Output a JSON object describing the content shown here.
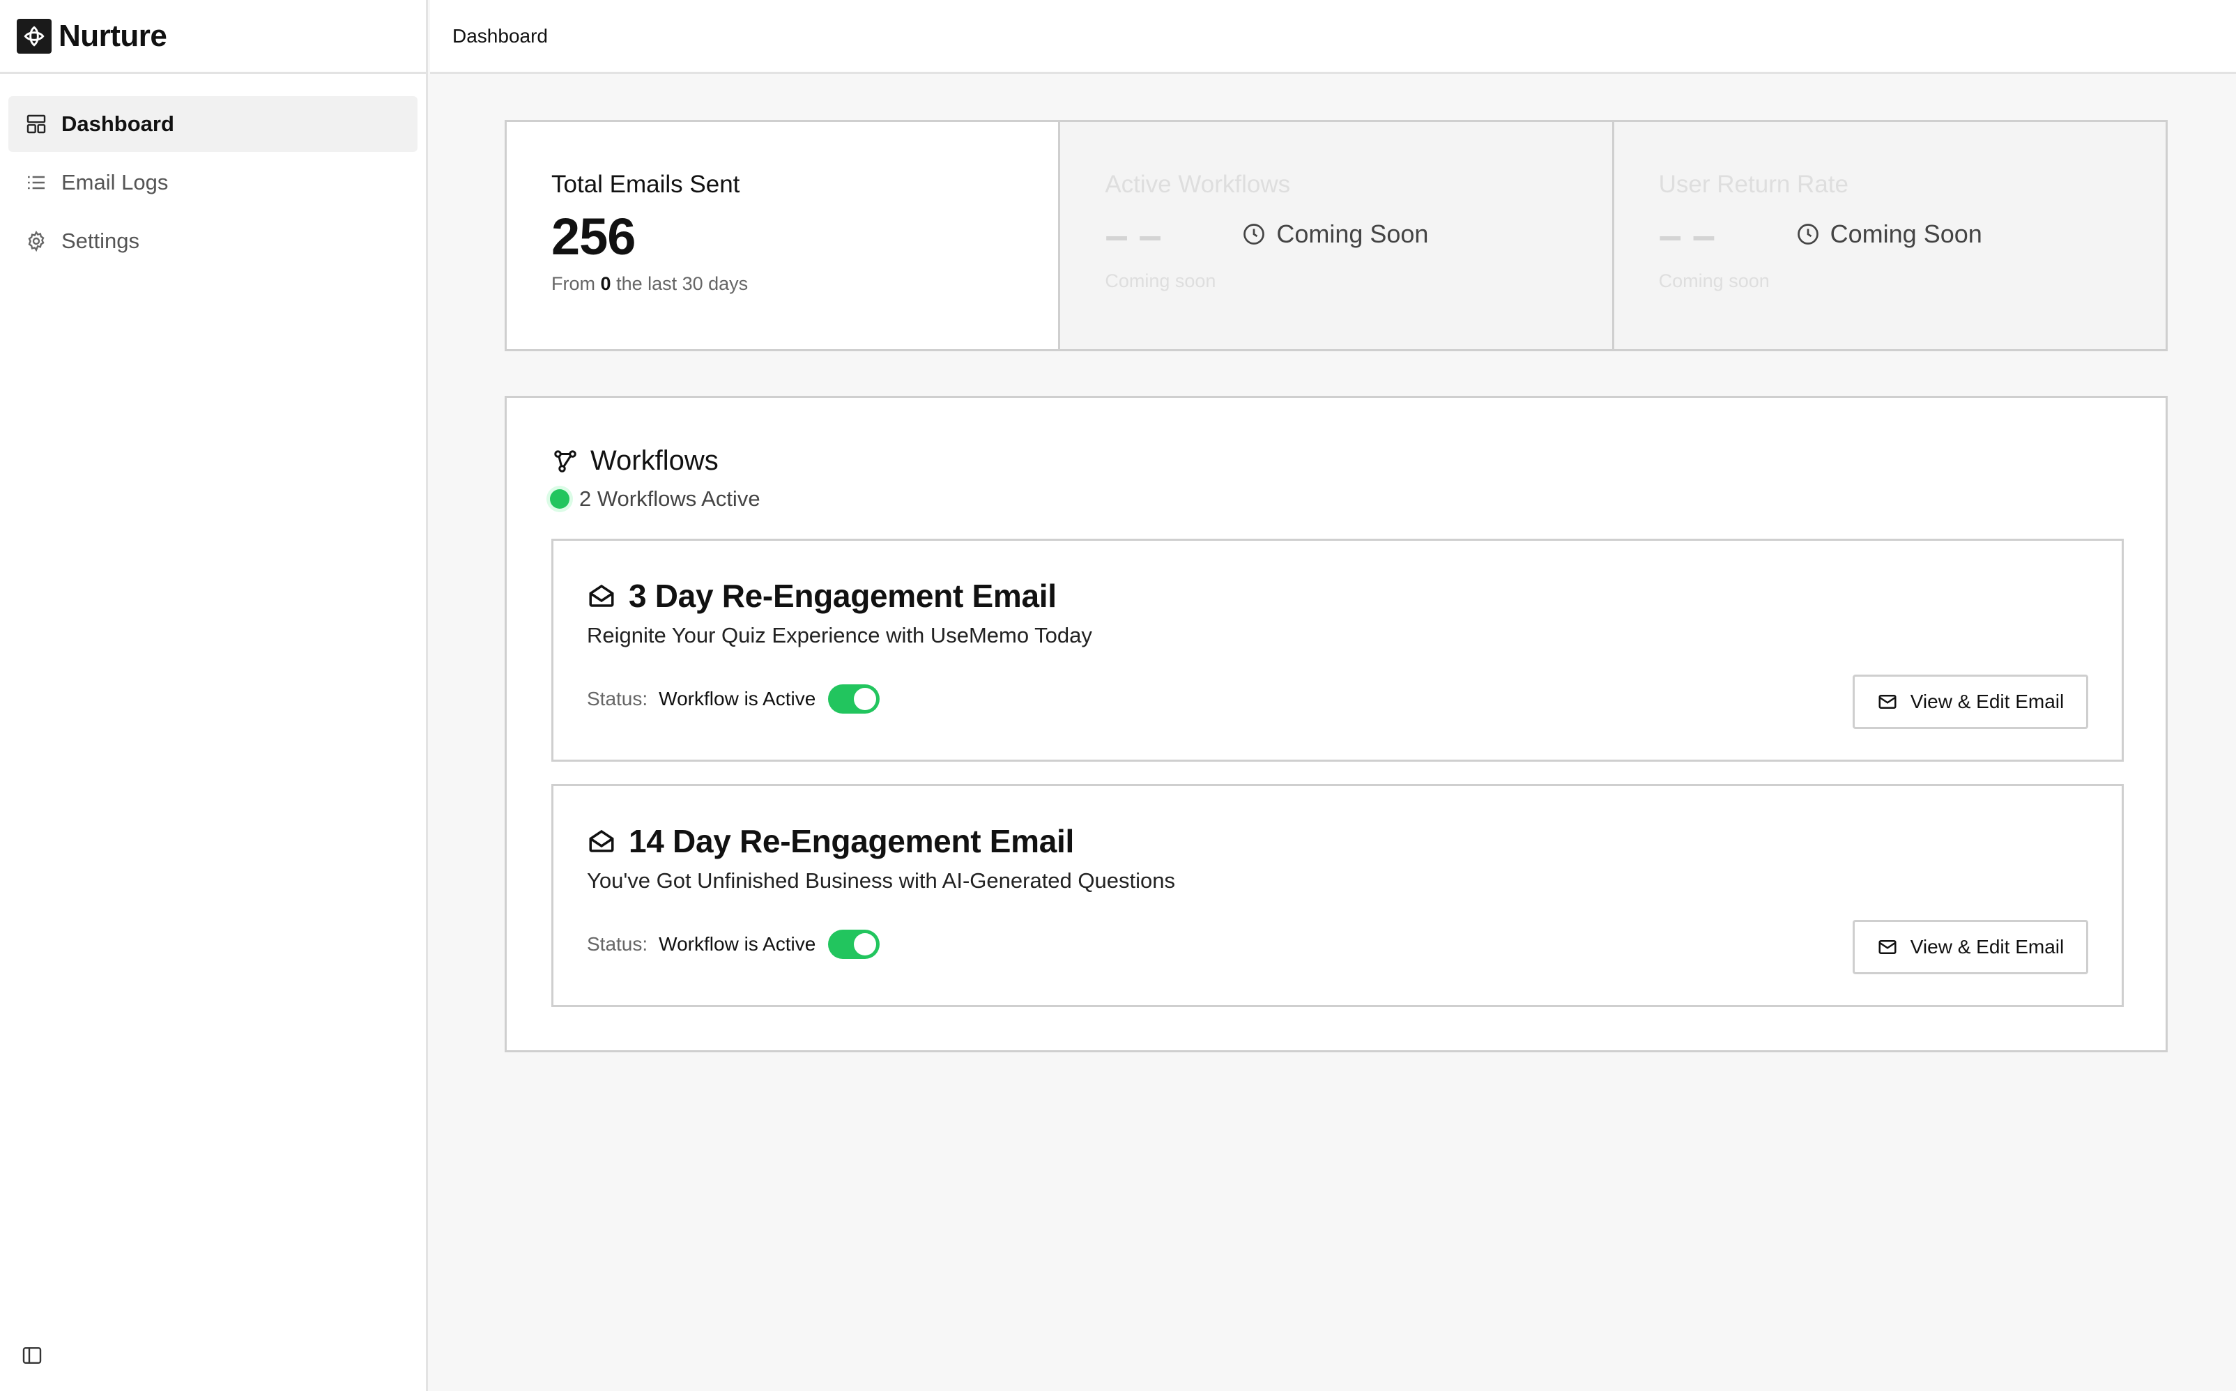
{
  "app": {
    "name": "Nurture"
  },
  "sidebar": {
    "items": [
      {
        "label": "Dashboard",
        "icon": "dashboard-icon",
        "active": true
      },
      {
        "label": "Email Logs",
        "icon": "list-icon",
        "active": false
      },
      {
        "label": "Settings",
        "icon": "gear-icon",
        "active": false
      }
    ]
  },
  "header": {
    "title": "Dashboard"
  },
  "stats": {
    "total_emails": {
      "label": "Total Emails Sent",
      "value": "256",
      "sub_prefix": "From",
      "sub_value": "0",
      "sub_suffix": "the last 30 days"
    },
    "active_workflows": {
      "label": "Active Workflows",
      "value": "– –",
      "sub": "Coming soon",
      "overlay": "Coming Soon"
    },
    "user_return_rate": {
      "label": "User Return Rate",
      "value": "– –",
      "sub": "Coming soon",
      "overlay": "Coming Soon"
    }
  },
  "workflows": {
    "title": "Workflows",
    "active_summary": "2 Workflows Active",
    "items": [
      {
        "title": "3 Day Re-Engagement Email",
        "subject": "Reignite Your Quiz Experience with UseMemo Today",
        "status_label": "Status:",
        "status_value": "Workflow is Active",
        "enabled": true,
        "button_label": "View & Edit Email"
      },
      {
        "title": "14 Day Re-Engagement Email",
        "subject": "You've Got Unfinished Business with AI-Generated Questions",
        "status_label": "Status:",
        "status_value": "Workflow is Active",
        "enabled": true,
        "button_label": "View & Edit Email"
      }
    ]
  },
  "colors": {
    "accent_green": "#22c55e",
    "border": "#cfcfcf"
  }
}
